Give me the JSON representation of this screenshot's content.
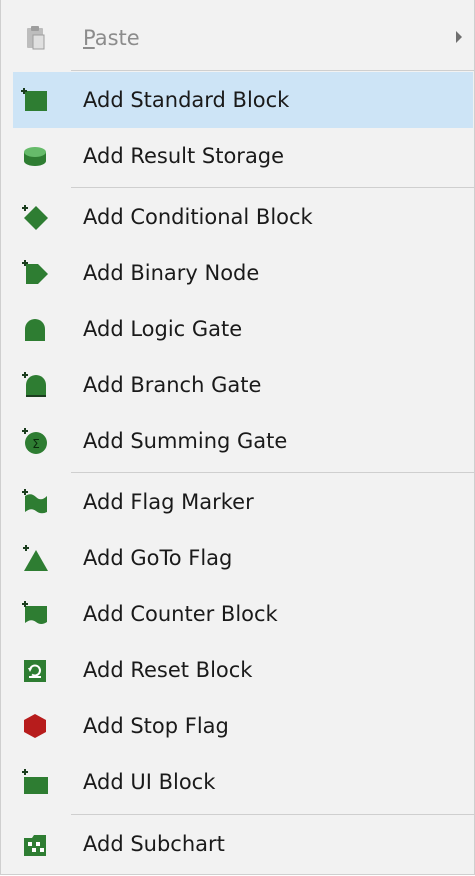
{
  "menu": {
    "paste": {
      "label_rest": "aste",
      "label_underline": "P"
    },
    "items": [
      {
        "label": "Add Standard Block",
        "icon": "standard-block-icon"
      },
      {
        "label": "Add Result Storage",
        "icon": "result-storage-icon"
      },
      {
        "label": "Add Conditional Block",
        "icon": "conditional-block-icon"
      },
      {
        "label": "Add Binary Node",
        "icon": "binary-node-icon"
      },
      {
        "label": "Add Logic Gate",
        "icon": "logic-gate-icon"
      },
      {
        "label": "Add Branch Gate",
        "icon": "branch-gate-icon"
      },
      {
        "label": "Add Summing Gate",
        "icon": "summing-gate-icon"
      },
      {
        "label": "Add Flag Marker",
        "icon": "flag-marker-icon"
      },
      {
        "label": "Add GoTo Flag",
        "icon": "goto-flag-icon"
      },
      {
        "label": "Add Counter Block",
        "icon": "counter-block-icon"
      },
      {
        "label": "Add Reset Block",
        "icon": "reset-block-icon"
      },
      {
        "label": "Add Stop Flag",
        "icon": "stop-flag-icon"
      },
      {
        "label": "Add UI Block",
        "icon": "ui-block-icon"
      },
      {
        "label": "Add Subchart",
        "icon": "subchart-icon"
      }
    ]
  },
  "colors": {
    "icon_green": "#2e7d32",
    "icon_green_dark": "#1b5e20",
    "stop_red": "#b71c1c",
    "highlight": "#cde4f6",
    "background": "#f2f2f2"
  }
}
